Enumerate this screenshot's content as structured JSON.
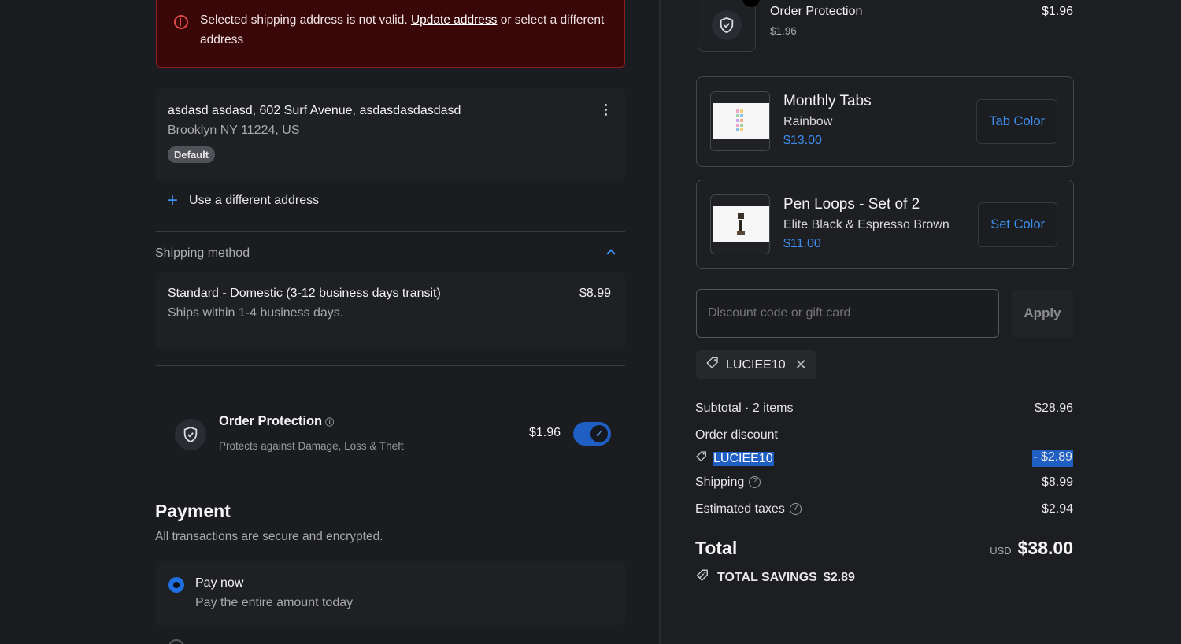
{
  "error": {
    "text_before": "Selected shipping address is not valid. ",
    "link": "Update address",
    "text_after": " or select a different address"
  },
  "address": {
    "line1": "asdasd asdasd, 602 Surf Avenue, asdasdasdasdasd",
    "line2": "Brooklyn NY 11224, US",
    "badge": "Default",
    "use_different": "Use a different address"
  },
  "shipping": {
    "heading": "Shipping method",
    "name": "Standard - Domestic (3-12 business days transit)",
    "sub": "Ships within 1-4 business days.",
    "price": "$8.99"
  },
  "order_protection": {
    "title": "Order Protection",
    "sub": "Protects against Damage, Loss & Theft",
    "price": "$1.96",
    "enabled": true
  },
  "payment": {
    "title": "Payment",
    "sub": "All transactions are secure and encrypted.",
    "option_label": "Pay now",
    "option_sub": "Pay the entire amount today"
  },
  "summary": {
    "protection_item": {
      "title": "Order Protection",
      "sub": "$1.96",
      "price": "$1.96"
    },
    "products": [
      {
        "name": "Monthly Tabs",
        "variant": "Rainbow",
        "price": "$13.00",
        "button": "Tab Color"
      },
      {
        "name": "Pen Loops - Set of 2",
        "variant": "Elite Black & Espresso Brown",
        "price": "$11.00",
        "button": "Set Color"
      }
    ],
    "discount_placeholder": "Discount code or gift card",
    "apply": "Apply",
    "applied_code": "LUCIEE10",
    "subtotal_label": "Subtotal · 2 items",
    "subtotal": "$28.96",
    "order_discount_label": "Order discount",
    "discount_code": "LUCIEE10",
    "discount_value": "- $2.89",
    "shipping_label": "Shipping",
    "shipping": "$8.99",
    "taxes_label": "Estimated taxes",
    "taxes": "$2.94",
    "total_label": "Total",
    "currency": "USD",
    "total": "$38.00",
    "savings_label": "TOTAL SAVINGS",
    "savings": "$2.89"
  },
  "colors": {
    "accent": "#3b8ff0",
    "error_bg": "#3a0708",
    "background": "#1a1b1e"
  }
}
